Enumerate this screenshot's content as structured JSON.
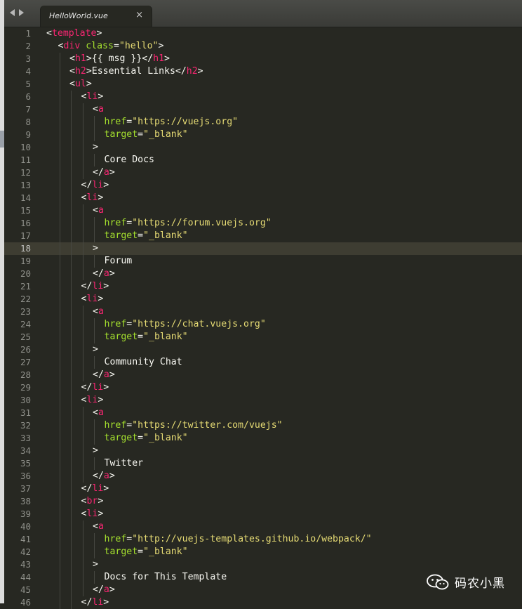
{
  "tab": {
    "title": "HelloWorld.vue",
    "close": "×"
  },
  "current_line": 18,
  "lines": [
    {
      "n": "1",
      "i": 0,
      "t": [
        [
          "pu",
          "<"
        ],
        [
          "tag",
          "template"
        ],
        [
          "pu",
          ">"
        ]
      ]
    },
    {
      "n": "2",
      "i": 1,
      "t": [
        [
          "pu",
          "<"
        ],
        [
          "tag",
          "div"
        ],
        [
          "pu",
          " "
        ],
        [
          "attr",
          "class"
        ],
        [
          "pu",
          "="
        ],
        [
          "str",
          "\"hello\""
        ],
        [
          "pu",
          ">"
        ]
      ]
    },
    {
      "n": "3",
      "i": 2,
      "t": [
        [
          "pu",
          "<"
        ],
        [
          "tag",
          "h1"
        ],
        [
          "pu",
          ">"
        ],
        [
          "txt",
          "{{ msg }}"
        ],
        [
          "pu",
          "</"
        ],
        [
          "tag",
          "h1"
        ],
        [
          "pu",
          ">"
        ]
      ]
    },
    {
      "n": "4",
      "i": 2,
      "t": [
        [
          "pu",
          "<"
        ],
        [
          "tag",
          "h2"
        ],
        [
          "pu",
          ">"
        ],
        [
          "txt",
          "Essential Links"
        ],
        [
          "pu",
          "</"
        ],
        [
          "tag",
          "h2"
        ],
        [
          "pu",
          ">"
        ]
      ]
    },
    {
      "n": "5",
      "i": 2,
      "t": [
        [
          "pu",
          "<"
        ],
        [
          "tag",
          "ul"
        ],
        [
          "pu",
          ">"
        ]
      ]
    },
    {
      "n": "6",
      "i": 3,
      "t": [
        [
          "pu",
          "<"
        ],
        [
          "tag",
          "li"
        ],
        [
          "pu",
          ">"
        ]
      ]
    },
    {
      "n": "7",
      "i": 4,
      "t": [
        [
          "pu",
          "<"
        ],
        [
          "tag",
          "a"
        ]
      ]
    },
    {
      "n": "8",
      "i": 5,
      "t": [
        [
          "attr",
          "href"
        ],
        [
          "pu",
          "="
        ],
        [
          "str",
          "\"https://vuejs.org\""
        ]
      ]
    },
    {
      "n": "9",
      "i": 5,
      "t": [
        [
          "attr",
          "target"
        ],
        [
          "pu",
          "="
        ],
        [
          "str",
          "\"_blank\""
        ]
      ]
    },
    {
      "n": "10",
      "i": 4,
      "t": [
        [
          "pu",
          ">"
        ]
      ]
    },
    {
      "n": "11",
      "i": 5,
      "t": [
        [
          "txt",
          "Core Docs"
        ]
      ]
    },
    {
      "n": "12",
      "i": 4,
      "t": [
        [
          "pu",
          "</"
        ],
        [
          "tag",
          "a"
        ],
        [
          "pu",
          ">"
        ]
      ]
    },
    {
      "n": "13",
      "i": 3,
      "t": [
        [
          "pu",
          "</"
        ],
        [
          "tag",
          "li"
        ],
        [
          "pu",
          ">"
        ]
      ]
    },
    {
      "n": "14",
      "i": 3,
      "t": [
        [
          "pu",
          "<"
        ],
        [
          "tag",
          "li"
        ],
        [
          "pu",
          ">"
        ]
      ]
    },
    {
      "n": "15",
      "i": 4,
      "t": [
        [
          "pu",
          "<"
        ],
        [
          "tag",
          "a"
        ]
      ]
    },
    {
      "n": "16",
      "i": 5,
      "t": [
        [
          "attr",
          "href"
        ],
        [
          "pu",
          "="
        ],
        [
          "str",
          "\"https://forum.vuejs.org\""
        ]
      ]
    },
    {
      "n": "17",
      "i": 5,
      "t": [
        [
          "attr",
          "target"
        ],
        [
          "pu",
          "="
        ],
        [
          "str",
          "\"_blank\""
        ]
      ]
    },
    {
      "n": "18",
      "i": 4,
      "t": [
        [
          "pu",
          ">"
        ]
      ]
    },
    {
      "n": "19",
      "i": 5,
      "t": [
        [
          "txt",
          "Forum"
        ]
      ]
    },
    {
      "n": "20",
      "i": 4,
      "t": [
        [
          "pu",
          "</"
        ],
        [
          "tag",
          "a"
        ],
        [
          "pu",
          ">"
        ]
      ]
    },
    {
      "n": "21",
      "i": 3,
      "t": [
        [
          "pu",
          "</"
        ],
        [
          "tag",
          "li"
        ],
        [
          "pu",
          ">"
        ]
      ]
    },
    {
      "n": "22",
      "i": 3,
      "t": [
        [
          "pu",
          "<"
        ],
        [
          "tag",
          "li"
        ],
        [
          "pu",
          ">"
        ]
      ]
    },
    {
      "n": "23",
      "i": 4,
      "t": [
        [
          "pu",
          "<"
        ],
        [
          "tag",
          "a"
        ]
      ]
    },
    {
      "n": "24",
      "i": 5,
      "t": [
        [
          "attr",
          "href"
        ],
        [
          "pu",
          "="
        ],
        [
          "str",
          "\"https://chat.vuejs.org\""
        ]
      ]
    },
    {
      "n": "25",
      "i": 5,
      "t": [
        [
          "attr",
          "target"
        ],
        [
          "pu",
          "="
        ],
        [
          "str",
          "\"_blank\""
        ]
      ]
    },
    {
      "n": "26",
      "i": 4,
      "t": [
        [
          "pu",
          ">"
        ]
      ]
    },
    {
      "n": "27",
      "i": 5,
      "t": [
        [
          "txt",
          "Community Chat"
        ]
      ]
    },
    {
      "n": "28",
      "i": 4,
      "t": [
        [
          "pu",
          "</"
        ],
        [
          "tag",
          "a"
        ],
        [
          "pu",
          ">"
        ]
      ]
    },
    {
      "n": "29",
      "i": 3,
      "t": [
        [
          "pu",
          "</"
        ],
        [
          "tag",
          "li"
        ],
        [
          "pu",
          ">"
        ]
      ]
    },
    {
      "n": "30",
      "i": 3,
      "t": [
        [
          "pu",
          "<"
        ],
        [
          "tag",
          "li"
        ],
        [
          "pu",
          ">"
        ]
      ]
    },
    {
      "n": "31",
      "i": 4,
      "t": [
        [
          "pu",
          "<"
        ],
        [
          "tag",
          "a"
        ]
      ]
    },
    {
      "n": "32",
      "i": 5,
      "t": [
        [
          "attr",
          "href"
        ],
        [
          "pu",
          "="
        ],
        [
          "str",
          "\"https://twitter.com/vuejs\""
        ]
      ]
    },
    {
      "n": "33",
      "i": 5,
      "t": [
        [
          "attr",
          "target"
        ],
        [
          "pu",
          "="
        ],
        [
          "str",
          "\"_blank\""
        ]
      ]
    },
    {
      "n": "34",
      "i": 4,
      "t": [
        [
          "pu",
          ">"
        ]
      ]
    },
    {
      "n": "35",
      "i": 5,
      "t": [
        [
          "txt",
          "Twitter"
        ]
      ]
    },
    {
      "n": "36",
      "i": 4,
      "t": [
        [
          "pu",
          "</"
        ],
        [
          "tag",
          "a"
        ],
        [
          "pu",
          ">"
        ]
      ]
    },
    {
      "n": "37",
      "i": 3,
      "t": [
        [
          "pu",
          "</"
        ],
        [
          "tag",
          "li"
        ],
        [
          "pu",
          ">"
        ]
      ]
    },
    {
      "n": "38",
      "i": 3,
      "t": [
        [
          "pu",
          "<"
        ],
        [
          "tag",
          "br"
        ],
        [
          "pu",
          ">"
        ]
      ]
    },
    {
      "n": "39",
      "i": 3,
      "t": [
        [
          "pu",
          "<"
        ],
        [
          "tag",
          "li"
        ],
        [
          "pu",
          ">"
        ]
      ]
    },
    {
      "n": "40",
      "i": 4,
      "t": [
        [
          "pu",
          "<"
        ],
        [
          "tag",
          "a"
        ]
      ]
    },
    {
      "n": "41",
      "i": 5,
      "t": [
        [
          "attr",
          "href"
        ],
        [
          "pu",
          "="
        ],
        [
          "str",
          "\"http://vuejs-templates.github.io/webpack/\""
        ]
      ]
    },
    {
      "n": "42",
      "i": 5,
      "t": [
        [
          "attr",
          "target"
        ],
        [
          "pu",
          "="
        ],
        [
          "str",
          "\"_blank\""
        ]
      ]
    },
    {
      "n": "43",
      "i": 4,
      "t": [
        [
          "pu",
          ">"
        ]
      ]
    },
    {
      "n": "44",
      "i": 5,
      "t": [
        [
          "txt",
          "Docs for This Template"
        ]
      ]
    },
    {
      "n": "45",
      "i": 4,
      "t": [
        [
          "pu",
          "</"
        ],
        [
          "tag",
          "a"
        ],
        [
          "pu",
          ">"
        ]
      ]
    },
    {
      "n": "46",
      "i": 3,
      "t": [
        [
          "pu",
          "</"
        ],
        [
          "tag",
          "li"
        ],
        [
          "pu",
          ">"
        ]
      ]
    }
  ],
  "watermark": {
    "text": "码农小黑",
    "icon": "wechat-icon"
  },
  "colors": {
    "background": "#272822",
    "tag": "#f92672",
    "attribute": "#a6e22e",
    "string": "#e6db74",
    "text": "#f8f8f2",
    "line_number": "#8f908a"
  }
}
